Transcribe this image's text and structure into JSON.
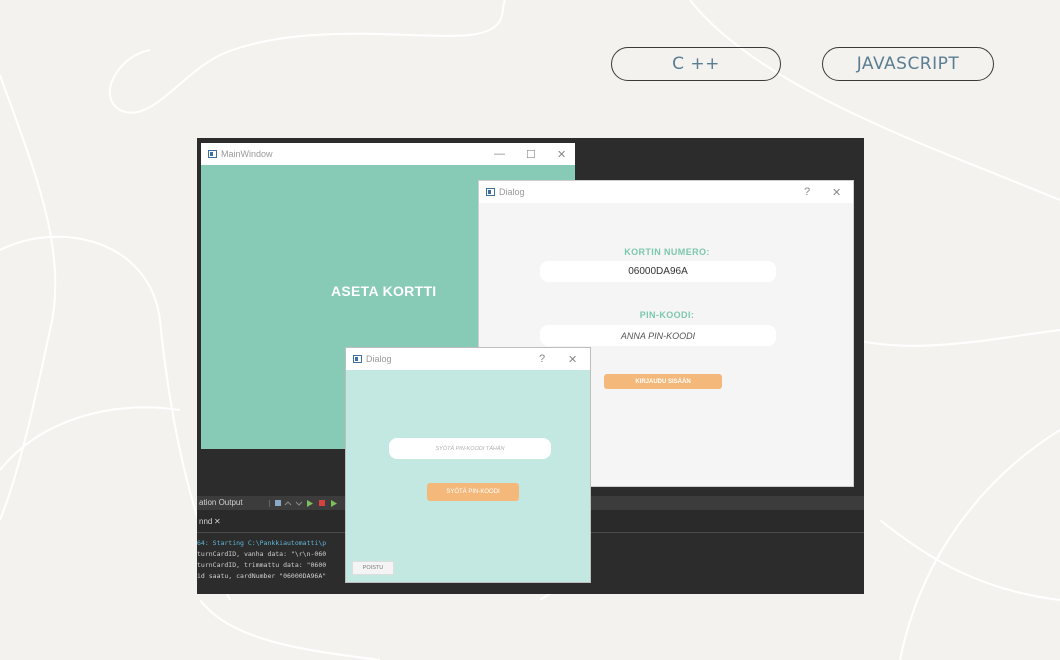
{
  "nav": {
    "cpp_label": "C ++",
    "js_label": "JAVASCRIPT"
  },
  "main_window": {
    "title": "MainWindow",
    "minimize": "—",
    "maximize": "☐",
    "close": "✕",
    "heading": "ASETA KORTTI"
  },
  "dialog_card": {
    "title": "Dialog",
    "help": "?",
    "close": "✕",
    "card_label": "KORTIN NUMERO:",
    "card_value": "06000DA96A",
    "pin_label": "PIN-KOODI:",
    "pin_placeholder": "ANNA PIN-KOODI",
    "login_button": "KIRJAUDU SISÄÄN"
  },
  "dialog_pin": {
    "title": "Dialog",
    "help": "?",
    "close": "✕",
    "pin_input_placeholder": "SYÖTÄ PIN-KOODI TÄHÄN",
    "submit_button": "SYÖTÄ PIN-KOODI",
    "exit_button": "POISTU"
  },
  "ide": {
    "output_label": "ation Output",
    "tab_label": "nnd",
    "tab_close": "✕",
    "console_lines": [
      "64: Starting C:\\Pankkiautomatti\\p",
      "turnCardID, vanha data:  \"\\r\\n-060",
      "turnCardID, trimmattu data:  \"0600",
      "id saatu, cardNumber \"06000DA96A\""
    ]
  },
  "colors": {
    "background": "#f4f2ee",
    "main_green": "#87cbb6",
    "dialog2_bg": "#c2e8e1",
    "accent_orange": "#f4b87a",
    "label_green": "#7cc7ae",
    "pill_text": "#5a7d93"
  }
}
